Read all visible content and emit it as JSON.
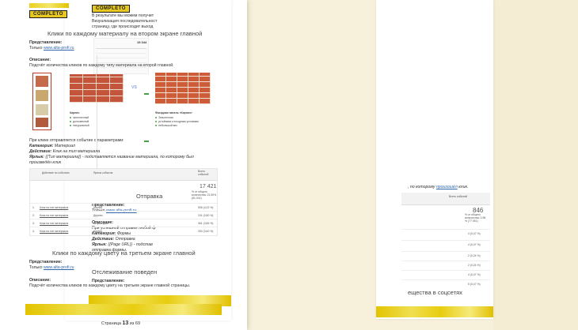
{
  "front": {
    "logo": "COMPLETO",
    "section1_title": "Клики по каждому материалу на втором экране главной",
    "representation_label": "Представление:",
    "representation_text": "Только",
    "site_link": "www.alta-profi.ru",
    "description_label": "Описание:",
    "description_text": "Подсчёт количества кликов по каждому типу материала на второй главной.",
    "vs": "VS",
    "left_caption": "Кирпич",
    "left_bullets": [
      "экологичный",
      "долговечный",
      "натуральный"
    ],
    "right_caption": "Фасадная панель «Кирпич»",
    "right_bullets": [
      "Эластичная",
      "устойчива к погодным условиям",
      "небольшой вес"
    ],
    "event_intro": "При клике отправляется событие с параметрами:",
    "category_label": "Категория:",
    "category_value": "Материал",
    "action_label": "Действие:",
    "action_value": "Клик на тип материала",
    "label_label": "Ярлык:",
    "label_value": "{{Тип материала}} - подставляется название материала, по которому был",
    "label_value_2": "произведён клик",
    "table": {
      "col1": "Действие по событию",
      "col2": "Ярлык события",
      "col3": "Всего событий",
      "total_value": "17 421",
      "total_sub": "% от общего количества: 21,50% (81 041)",
      "rows": [
        {
          "n": "1.",
          "action": "Клик на тип материала",
          "label": "Кирпич",
          "value": "506 (4,02 %)"
        },
        {
          "n": "2.",
          "action": "Клик на тип материала",
          "label": "Дерево",
          "value": "101 (0,80 %)"
        },
        {
          "n": "3.",
          "action": "Клик на тип материала",
          "label": "Штукатурка",
          "value": "361 (3,86 %)"
        },
        {
          "n": "4.",
          "action": "Клик на тип материала",
          "label": "Кирпич",
          "value": "254 (3,60 %)"
        }
      ]
    },
    "section2_title": "Клики по каждому цвету на третьем экране главной",
    "description2_text": "Подсчёт количества кликов по каждому цвету на третьем экране главной страницы.",
    "page_label": "Страница",
    "page_num": "13",
    "page_of": "из 69"
  },
  "left": {
    "logo": "COMPLETO",
    "para1": "В результате мы можем получит",
    "para2": "Визуализация последовательност",
    "para3": "страницу, где происходит выход",
    "total": "19 344",
    "heading_send": "Отправка",
    "representation_label": "Представление:",
    "representation_text": "Только",
    "site_link": "www.alta-profi.ru",
    "description_label": "Описание:",
    "desc_line": "При успешной отправке любой ф",
    "category_label": "Категория:",
    "category_value": "Формы",
    "action_label": "Действие:",
    "action_value": "Отправка",
    "label_label": "Ярлык:",
    "label_value": "{{Page URL}} - подстав",
    "label_value_2": "отправка формы.",
    "heading_tracking": "Отслеживание поведен",
    "representation_label_2": "Представление:"
  },
  "right": {
    "text_line": ", по которому",
    "text_link": "произошёл",
    "text_end": "клик.",
    "col_header": "Всего событий",
    "total": "846",
    "total_sub": "% от общего количества: 0,98 % (77 451)",
    "values": [
      "4 (0,47 %)",
      "4 (0,47 %)",
      "2 (0,24 %)",
      "2 (0,24 %)",
      "4 (0,47 %)",
      "5 (0,47 %)"
    ],
    "footer_heading": "ещества в соцсетях"
  }
}
